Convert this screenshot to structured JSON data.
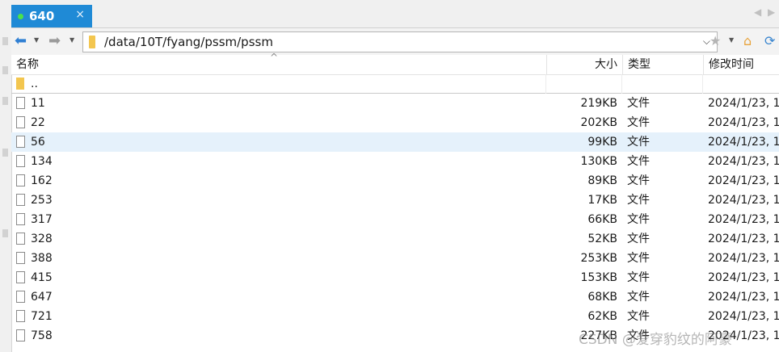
{
  "tab": {
    "title": "640",
    "close": "×"
  },
  "tab_nav": {
    "left": "◀",
    "right": "▶"
  },
  "toolbar": {
    "back_icon": "arrow-left-icon",
    "forward_icon": "arrow-right-icon",
    "address_path": "/data/10T/fyang/pssm/pssm",
    "dropdown_glyph": "⌵"
  },
  "columns": {
    "name": "名称",
    "size": "大小",
    "type": "类型",
    "modified": "修改时间"
  },
  "parent_row": {
    "name": ".."
  },
  "rows": [
    {
      "name": "11",
      "size": "219KB",
      "type": "文件",
      "modified": "2024/1/23, 1"
    },
    {
      "name": "22",
      "size": "202KB",
      "type": "文件",
      "modified": "2024/1/23, 1"
    },
    {
      "name": "56",
      "size": "99KB",
      "type": "文件",
      "modified": "2024/1/23, 1"
    },
    {
      "name": "134",
      "size": "130KB",
      "type": "文件",
      "modified": "2024/1/23, 1"
    },
    {
      "name": "162",
      "size": "89KB",
      "type": "文件",
      "modified": "2024/1/23, 1"
    },
    {
      "name": "253",
      "size": "17KB",
      "type": "文件",
      "modified": "2024/1/23, 1"
    },
    {
      "name": "317",
      "size": "66KB",
      "type": "文件",
      "modified": "2024/1/23, 1"
    },
    {
      "name": "328",
      "size": "52KB",
      "type": "文件",
      "modified": "2024/1/23, 1"
    },
    {
      "name": "388",
      "size": "253KB",
      "type": "文件",
      "modified": "2024/1/23, 1"
    },
    {
      "name": "415",
      "size": "153KB",
      "type": "文件",
      "modified": "2024/1/23, 1"
    },
    {
      "name": "647",
      "size": "68KB",
      "type": "文件",
      "modified": "2024/1/23, 1"
    },
    {
      "name": "721",
      "size": "62KB",
      "type": "文件",
      "modified": "2024/1/23, 1"
    },
    {
      "name": "758",
      "size": "227KB",
      "type": "文件",
      "modified": "2024/1/23, 1"
    }
  ],
  "watermark": "CSDN @爱穿豹纹的阿豪",
  "colors": {
    "tab_active": "#1f8ad6",
    "selected_row": "#e5f1fb",
    "status_dot": "#4be24b"
  }
}
